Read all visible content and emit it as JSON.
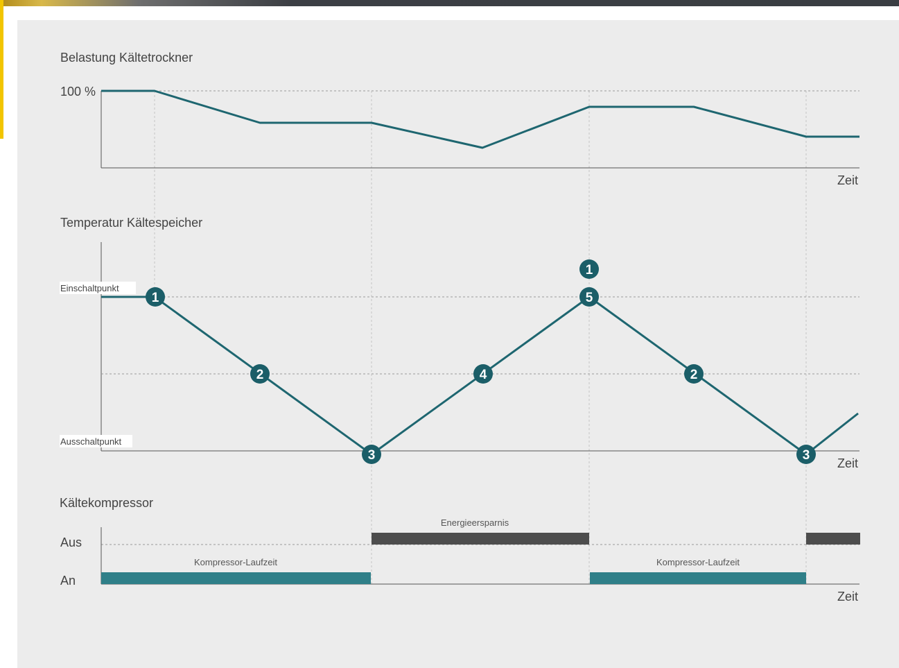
{
  "colors": {
    "line": "#1e6670",
    "marker": "#1b5e68",
    "bar_on": "#2f7f88",
    "bar_off": "#4d4d4d",
    "axis": "#555555",
    "grid": "#9a9a9a",
    "panel": "#ececec"
  },
  "charts": {
    "load": {
      "title": "Belastung Kältetrockner",
      "y_tick": "100 %",
      "x_label": "Zeit"
    },
    "temperature": {
      "title": "Temperatur Kältespeicher",
      "on_point_label": "Einschaltpunkt",
      "off_point_label": "Ausschaltpunkt",
      "x_label": "Zeit",
      "markers": [
        "1",
        "2",
        "3",
        "4",
        "5",
        "2",
        "3"
      ],
      "extra_marker": "1"
    },
    "compressor": {
      "title": "Kältekompressor",
      "off_label": "Aus",
      "on_label": "An",
      "x_label": "Zeit",
      "runtime_label_1": "Kompressor-Laufzeit",
      "saving_label": "Energieersparnis",
      "runtime_label_2": "Kompressor-Laufzeit"
    }
  }
}
